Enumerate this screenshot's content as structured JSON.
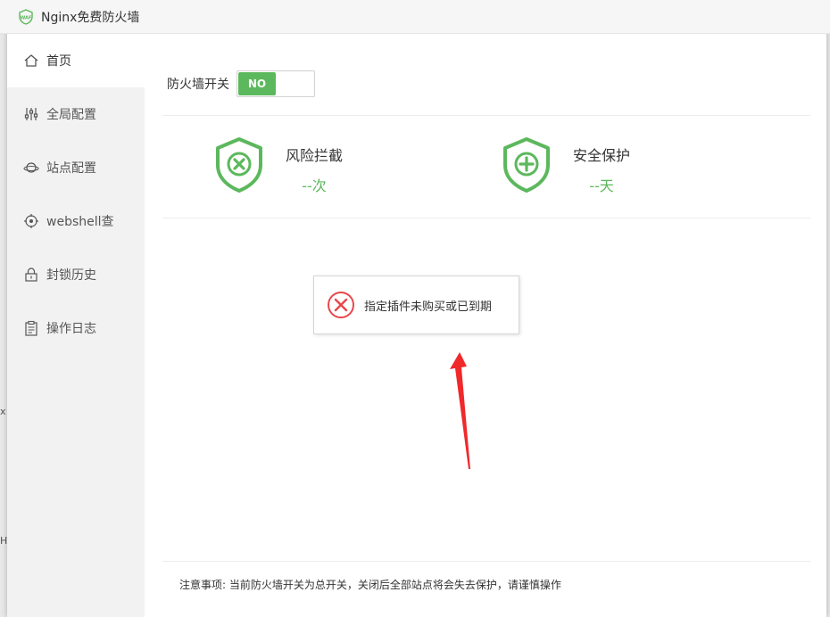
{
  "window": {
    "title": "Nginx免费防火墙",
    "logo_icon": "waf-shield-logo"
  },
  "backdrop": {
    "peek_x": "x",
    "peek_h": "H"
  },
  "sidebar": {
    "items": [
      {
        "label": "首页",
        "icon": "home-icon",
        "active": true
      },
      {
        "label": "全局配置",
        "icon": "sliders-icon",
        "active": false
      },
      {
        "label": "站点配置",
        "icon": "planet-icon",
        "active": false
      },
      {
        "label": "webshell查",
        "icon": "target-icon",
        "active": false
      },
      {
        "label": "封锁历史",
        "icon": "lock-icon",
        "active": false
      },
      {
        "label": "操作日志",
        "icon": "clipboard-icon",
        "active": false
      }
    ]
  },
  "main": {
    "switch": {
      "label": "防火墙开关",
      "state": "NO"
    },
    "stats": [
      {
        "label": "风险拦截",
        "value": "--次",
        "icon": "shield-x-icon"
      },
      {
        "label": "安全保护",
        "value": "--天",
        "icon": "shield-plus-icon"
      }
    ],
    "popup": {
      "message": "指定插件未购买或已到期",
      "icon": "error-circle-icon"
    },
    "notice": "注意事项: 当前防火墙开关为总开关，关闭后全部站点将会失去保护，请谨慎操作"
  },
  "colors": {
    "accent": "#5cb85c",
    "error": "#e9474a",
    "arrow": "#f0292a"
  }
}
